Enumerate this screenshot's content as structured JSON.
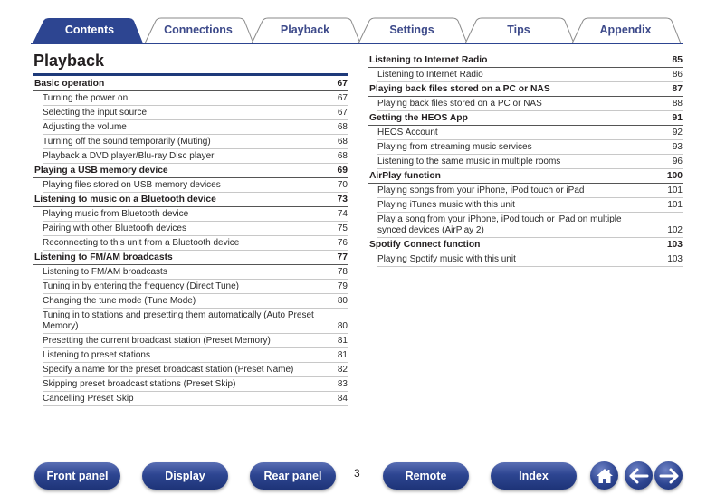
{
  "colors": {
    "brand_blue": "#2d4591",
    "tab_border": "#8a8a8a",
    "tab_text": "#3d4a8a"
  },
  "tabs": [
    {
      "label": "Contents",
      "active": true
    },
    {
      "label": "Connections",
      "active": false
    },
    {
      "label": "Playback",
      "active": false
    },
    {
      "label": "Settings",
      "active": false
    },
    {
      "label": "Tips",
      "active": false
    },
    {
      "label": "Appendix",
      "active": false
    }
  ],
  "page": {
    "title": "Playback",
    "page_number": "3"
  },
  "toc": {
    "left": [
      {
        "type": "section",
        "title": "Basic operation",
        "page": "67"
      },
      {
        "type": "item",
        "title": "Turning the power on",
        "page": "67"
      },
      {
        "type": "item",
        "title": "Selecting the input source",
        "page": "67"
      },
      {
        "type": "item",
        "title": "Adjusting the volume",
        "page": "68"
      },
      {
        "type": "item",
        "title": "Turning off the sound temporarily (Muting)",
        "page": "68"
      },
      {
        "type": "item",
        "title": "Playback a DVD player/Blu-ray Disc player",
        "page": "68"
      },
      {
        "type": "section",
        "title": "Playing a USB memory device",
        "page": "69"
      },
      {
        "type": "item",
        "title": "Playing files stored on USB memory devices",
        "page": "70"
      },
      {
        "type": "section",
        "title": "Listening to music on a Bluetooth device",
        "page": "73"
      },
      {
        "type": "item",
        "title": "Playing music from Bluetooth device",
        "page": "74"
      },
      {
        "type": "item",
        "title": "Pairing with other Bluetooth devices",
        "page": "75"
      },
      {
        "type": "item",
        "title": "Reconnecting to this unit from a Bluetooth device",
        "page": "76"
      },
      {
        "type": "section",
        "title": "Listening to FM/AM broadcasts",
        "page": "77"
      },
      {
        "type": "item",
        "title": "Listening to FM/AM broadcasts",
        "page": "78"
      },
      {
        "type": "item",
        "title": "Tuning in by entering the frequency (Direct Tune)",
        "page": "79"
      },
      {
        "type": "item",
        "title": "Changing the tune mode (Tune Mode)",
        "page": "80"
      },
      {
        "type": "item",
        "title": "Tuning in to stations and presetting them automatically (Auto Preset Memory)",
        "page": "80"
      },
      {
        "type": "item",
        "title": "Presetting the current broadcast station (Preset Memory)",
        "page": "81"
      },
      {
        "type": "item",
        "title": "Listening to preset stations",
        "page": "81"
      },
      {
        "type": "item",
        "title": "Specify a name for the preset broadcast station (Preset Name)",
        "page": "82"
      },
      {
        "type": "item",
        "title": "Skipping preset broadcast stations (Preset Skip)",
        "page": "83"
      },
      {
        "type": "item",
        "title": "Cancelling Preset Skip",
        "page": "84"
      }
    ],
    "right": [
      {
        "type": "section",
        "title": "Listening to Internet Radio",
        "page": "85"
      },
      {
        "type": "item",
        "title": "Listening to Internet Radio",
        "page": "86"
      },
      {
        "type": "section",
        "title": "Playing back files stored on a PC or NAS",
        "page": "87"
      },
      {
        "type": "item",
        "title": "Playing back files stored on a PC or NAS",
        "page": "88"
      },
      {
        "type": "section",
        "title": "Getting the HEOS App",
        "page": "91"
      },
      {
        "type": "item",
        "title": "HEOS Account",
        "page": "92"
      },
      {
        "type": "item",
        "title": "Playing from streaming music services",
        "page": "93"
      },
      {
        "type": "item",
        "title": "Listening to the same music in multiple rooms",
        "page": "96"
      },
      {
        "type": "section",
        "title": "AirPlay function",
        "page": "100"
      },
      {
        "type": "item",
        "title": "Playing songs from your iPhone, iPod touch or iPad",
        "page": "101"
      },
      {
        "type": "item",
        "title": "Playing iTunes music with this unit",
        "page": "101"
      },
      {
        "type": "item",
        "title": "Play a song from your iPhone, iPod touch or iPad on multiple synced devices (AirPlay 2)",
        "page": "102"
      },
      {
        "type": "section",
        "title": "Spotify Connect function",
        "page": "103"
      },
      {
        "type": "item",
        "title": "Playing Spotify music with this unit",
        "page": "103"
      }
    ]
  },
  "footer": {
    "buttons": [
      "Front panel",
      "Display",
      "Rear panel",
      "Remote",
      "Index"
    ],
    "icons": [
      "home-icon",
      "arrow-left-icon",
      "arrow-right-icon"
    ]
  }
}
